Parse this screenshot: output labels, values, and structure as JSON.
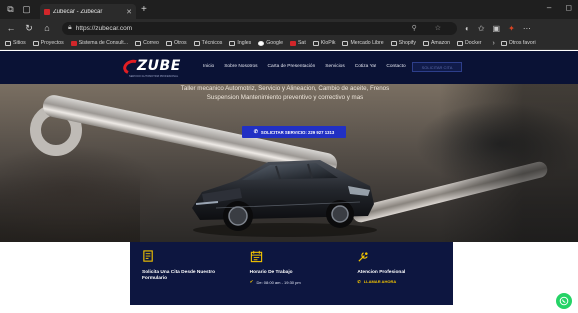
{
  "browser": {
    "tab_title": "Zubecar - Zubecar",
    "url": "https://zubecar.com",
    "bookmarks": [
      "Sitios",
      "Proyectos",
      "Sistema de Consult...",
      "Correo",
      "Otros",
      "Técnicos",
      "Ingles",
      "Google",
      "Sat",
      "KloPik",
      "Mercado Libre",
      "Shopify",
      "Amazon",
      "Docker"
    ],
    "bookmarks_more": "Otros favori"
  },
  "site": {
    "logo_text": "ZUBE",
    "logo_tagline": "SERVICIO AUTOMOTRIZ PROFESIONAL",
    "menu": [
      "Inicio",
      "Sobre Nosotros",
      "Carta de Presentación",
      "Servicios",
      "Cotiza Ya!",
      "Contacto"
    ],
    "menu_button": "SOLICITAR CITA"
  },
  "hero": {
    "line1": "Taller mecanico Automotriz, Servicio y Alineacion, Cambio de aceite, Frenos",
    "line2": "Suspension Mantenimiento preventivo y correctivo y mas",
    "cta": "SOLICITAR SERVICIO: 229 927 1313"
  },
  "info": [
    {
      "title": "Solicita Una Cita Desde Nuestro Formulario",
      "sub": "",
      "link": ""
    },
    {
      "title": "Horario De Trabajo",
      "sub": "De: 08:00 am - 19:30 pm",
      "link": ""
    },
    {
      "title": "Atencion Profesional",
      "sub": "",
      "link": "LLAMAR AHORA"
    }
  ],
  "colors": {
    "nav_bg": "#0a1235",
    "panel_bg": "#0d1640",
    "cta_bg": "#2130c4",
    "accent_yellow": "#f2c300",
    "logo_red": "#e11d22",
    "whatsapp": "#25d366"
  }
}
